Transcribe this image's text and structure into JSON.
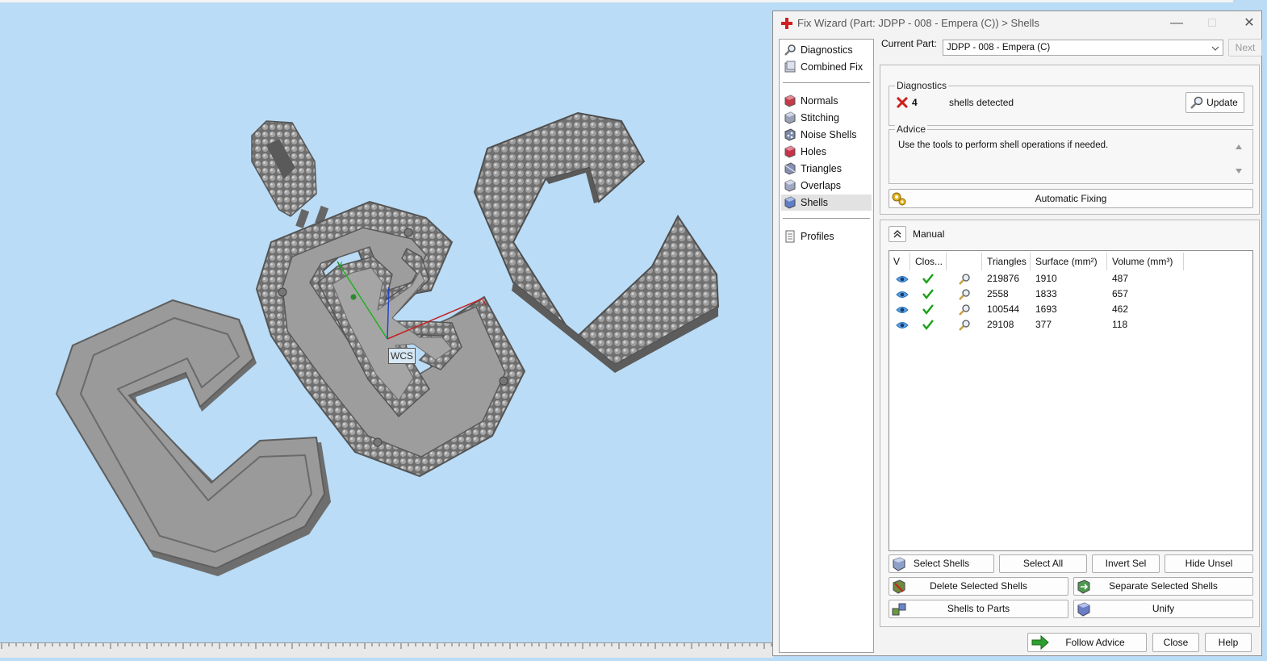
{
  "window": {
    "title": "Fix Wizard (Part: JDPP - 008 - Empera  (C)) > Shells"
  },
  "viewport": {
    "wcs_label": "WCS",
    "axis_x": "x",
    "axis_y": "y"
  },
  "nav": {
    "items": [
      {
        "label": "Diagnostics",
        "icon": "magnifier-icon"
      },
      {
        "label": "Combined Fix",
        "icon": "combined-fix-icon"
      },
      {
        "label": "Normals",
        "icon": "normals-cube-icon"
      },
      {
        "label": "Stitching",
        "icon": "stitching-cube-icon"
      },
      {
        "label": "Noise Shells",
        "icon": "noise-shells-icon"
      },
      {
        "label": "Holes",
        "icon": "holes-cube-icon"
      },
      {
        "label": "Triangles",
        "icon": "triangles-cube-icon"
      },
      {
        "label": "Overlaps",
        "icon": "overlaps-cube-icon"
      },
      {
        "label": "Shells",
        "icon": "shells-cube-icon",
        "selected": true
      },
      {
        "label": "Profiles",
        "icon": "profiles-icon"
      }
    ]
  },
  "current_part": {
    "label": "Current Part:",
    "value": "JDPP - 008 - Empera  (C)",
    "next_label": "Next"
  },
  "diagnostics": {
    "title": "Diagnostics",
    "count": "4",
    "message": "shells detected",
    "update_label": "Update"
  },
  "advice": {
    "title": "Advice",
    "text": "Use the tools to perform shell operations if needed."
  },
  "automatic_fixing_label": "Automatic Fixing",
  "manual": {
    "title": "Manual",
    "columns": [
      "V",
      "Clos...",
      "",
      "Triangles",
      "Surface (mm²)",
      "Volume (mm³)"
    ],
    "rows": [
      {
        "triangles": "219876",
        "surface": "1910",
        "volume": "487"
      },
      {
        "triangles": "2558",
        "surface": "1833",
        "volume": "657"
      },
      {
        "triangles": "100544",
        "surface": "1693",
        "volume": "462"
      },
      {
        "triangles": "29108",
        "surface": "377",
        "volume": "118"
      }
    ]
  },
  "actions": {
    "select_shells": "Select Shells",
    "select_all": "Select All",
    "invert_sel": "Invert Sel",
    "hide_unsel": "Hide Unsel",
    "delete_selected": "Delete Selected Shells",
    "separate_selected": "Separate Selected Shells",
    "shells_to_parts": "Shells to Parts",
    "unify": "Unify"
  },
  "footer": {
    "follow_advice": "Follow Advice",
    "close": "Close",
    "help": "Help"
  },
  "colors": {
    "viewport_bg": "#badcf6",
    "model_gray": "#8a8a8a",
    "error_red": "#d02020",
    "check_green": "#1aa01a"
  }
}
